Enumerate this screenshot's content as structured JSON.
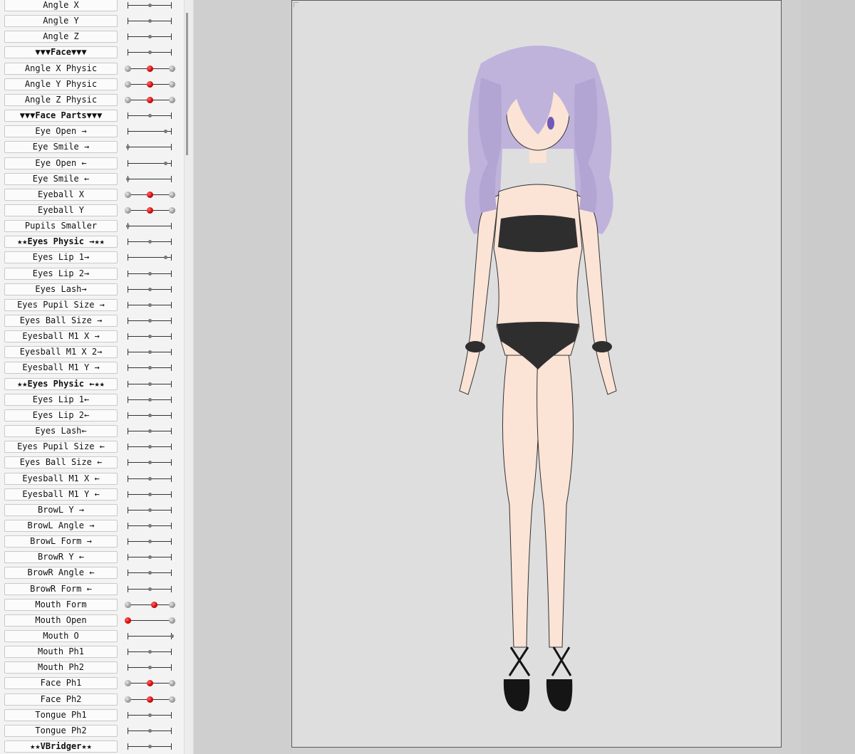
{
  "parameters": [
    {
      "label": "Angle X",
      "value": 0.5,
      "style": "plain"
    },
    {
      "label": "Angle Y",
      "value": 0.5,
      "style": "plain"
    },
    {
      "label": "Angle Z",
      "value": 0.5,
      "style": "plain"
    },
    {
      "label": "▼▼▼Face▼▼▼",
      "value": 0.5,
      "style": "plain",
      "header": true
    },
    {
      "label": "Angle X Physic",
      "value": 0.5,
      "style": "red"
    },
    {
      "label": "Angle Y Physic",
      "value": 0.5,
      "style": "red"
    },
    {
      "label": "Angle Z Physic",
      "value": 0.5,
      "style": "red"
    },
    {
      "label": "▼▼▼Face Parts▼▼▼",
      "value": 0.5,
      "style": "plain",
      "header": true
    },
    {
      "label": "Eye Open →",
      "value": 0.85,
      "style": "plain"
    },
    {
      "label": "Eye Smile →",
      "value": 0.0,
      "style": "plain"
    },
    {
      "label": "Eye Open ←",
      "value": 0.85,
      "style": "plain"
    },
    {
      "label": "Eye Smile ←",
      "value": 0.0,
      "style": "plain"
    },
    {
      "label": "Eyeball X",
      "value": 0.5,
      "style": "red"
    },
    {
      "label": "Eyeball Y",
      "value": 0.5,
      "style": "red"
    },
    {
      "label": "Pupils Smaller",
      "value": 0.0,
      "style": "plain"
    },
    {
      "label": "★★Eyes Physic →★★",
      "value": 0.5,
      "style": "plain",
      "header": true
    },
    {
      "label": "Eyes Lip 1→",
      "value": 0.85,
      "style": "plain"
    },
    {
      "label": "Eyes Lip 2→",
      "value": 0.5,
      "style": "plain"
    },
    {
      "label": "Eyes Lash→",
      "value": 0.5,
      "style": "plain"
    },
    {
      "label": "Eyes Pupil Size →",
      "value": 0.5,
      "style": "plain"
    },
    {
      "label": "Eyes Ball Size →",
      "value": 0.5,
      "style": "plain"
    },
    {
      "label": "Eyesball M1 X →",
      "value": 0.5,
      "style": "plain"
    },
    {
      "label": "Eyesball M1 X 2→",
      "value": 0.5,
      "style": "plain"
    },
    {
      "label": "Eyesball M1 Y →",
      "value": 0.5,
      "style": "plain"
    },
    {
      "label": "★★Eyes Physic ←★★",
      "value": 0.5,
      "style": "plain",
      "header": true
    },
    {
      "label": "Eyes Lip 1←",
      "value": 0.5,
      "style": "plain"
    },
    {
      "label": "Eyes Lip 2←",
      "value": 0.5,
      "style": "plain"
    },
    {
      "label": "Eyes Lash←",
      "value": 0.5,
      "style": "plain"
    },
    {
      "label": "Eyes Pupil Size ←",
      "value": 0.5,
      "style": "plain"
    },
    {
      "label": "Eyes Ball Size ←",
      "value": 0.5,
      "style": "plain"
    },
    {
      "label": "Eyesball M1 X ←",
      "value": 0.5,
      "style": "plain"
    },
    {
      "label": "Eyesball M1 Y ←",
      "value": 0.5,
      "style": "plain"
    },
    {
      "label": "BrowL Y →",
      "value": 0.5,
      "style": "plain"
    },
    {
      "label": "BrowL Angle →",
      "value": 0.5,
      "style": "plain"
    },
    {
      "label": "BrowL Form →",
      "value": 0.5,
      "style": "plain"
    },
    {
      "label": "BrowR Y ←",
      "value": 0.5,
      "style": "plain"
    },
    {
      "label": "BrowR Angle ←",
      "value": 0.5,
      "style": "plain"
    },
    {
      "label": "BrowR Form ←",
      "value": 0.5,
      "style": "plain"
    },
    {
      "label": "Mouth Form",
      "value": 0.6,
      "style": "red"
    },
    {
      "label": "Mouth Open",
      "value": 0.0,
      "style": "red-start"
    },
    {
      "label": "Mouth O",
      "value": 1.0,
      "style": "plain"
    },
    {
      "label": "Mouth Ph1",
      "value": 0.5,
      "style": "plain"
    },
    {
      "label": "Mouth Ph2",
      "value": 0.5,
      "style": "plain"
    },
    {
      "label": "Face Ph1",
      "value": 0.5,
      "style": "red"
    },
    {
      "label": "Face Ph2",
      "value": 0.5,
      "style": "red"
    },
    {
      "label": "Tongue Ph1",
      "value": 0.5,
      "style": "plain"
    },
    {
      "label": "Tongue Ph2",
      "value": 0.5,
      "style": "plain"
    },
    {
      "label": "★★VBridger★★",
      "value": 0.5,
      "style": "plain",
      "header": true
    }
  ],
  "colors": {
    "hair": "#bfb3dc",
    "hair_shade": "#9d8fc6",
    "skin": "#fbe3d6",
    "skin_shade": "#f1c9b6",
    "swimsuit": "#2e2e2e",
    "canvas_bg": "#dedede",
    "active_handle": "#d00000"
  },
  "icons": {
    "figure": "character-model-icon"
  }
}
